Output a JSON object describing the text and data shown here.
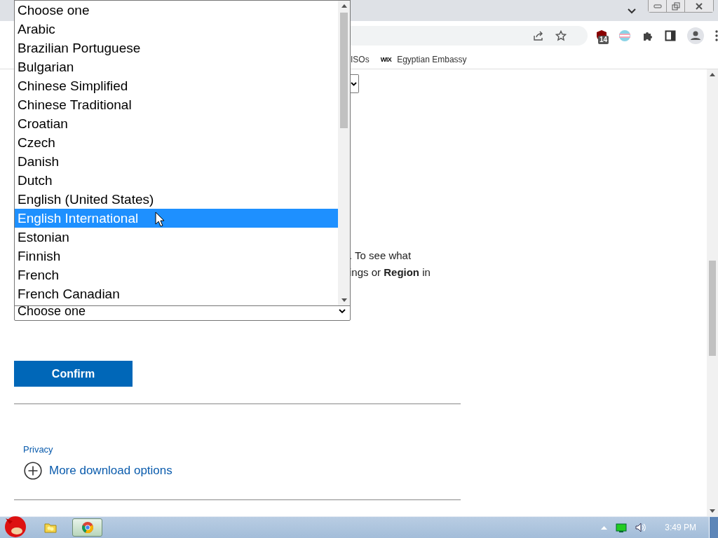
{
  "extensions": {
    "badge": "14"
  },
  "bookmarks": [
    {
      "label": "ISOs"
    },
    {
      "label": "Egyptian Embassy",
      "icon_text": "WIX"
    }
  ],
  "page": {
    "text_lines": [
      ". To see what",
      "ings or **Region** in"
    ],
    "select": {
      "value": "Choose one"
    },
    "confirm_button": "Confirm",
    "privacy_link": "Privacy",
    "more_options": "More download options"
  },
  "listbox": {
    "options": [
      {
        "label": "Choose one",
        "selected": false
      },
      {
        "label": "Arabic",
        "selected": false
      },
      {
        "label": "Brazilian Portuguese",
        "selected": false
      },
      {
        "label": "Bulgarian",
        "selected": false
      },
      {
        "label": "Chinese Simplified",
        "selected": false
      },
      {
        "label": "Chinese Traditional",
        "selected": false
      },
      {
        "label": "Croatian",
        "selected": false
      },
      {
        "label": "Czech",
        "selected": false
      },
      {
        "label": "Danish",
        "selected": false
      },
      {
        "label": "Dutch",
        "selected": false
      },
      {
        "label": "English (United States)",
        "selected": false
      },
      {
        "label": "English International",
        "selected": true
      },
      {
        "label": "Estonian",
        "selected": false
      },
      {
        "label": "Finnish",
        "selected": false
      },
      {
        "label": "French",
        "selected": false
      },
      {
        "label": "French Canadian",
        "selected": false
      }
    ]
  },
  "taskbar": {
    "apps": [
      {
        "kind": "start"
      },
      {
        "kind": "folder",
        "selected": false
      },
      {
        "kind": "browser",
        "selected": true
      }
    ],
    "clock": "3:49 PM"
  }
}
